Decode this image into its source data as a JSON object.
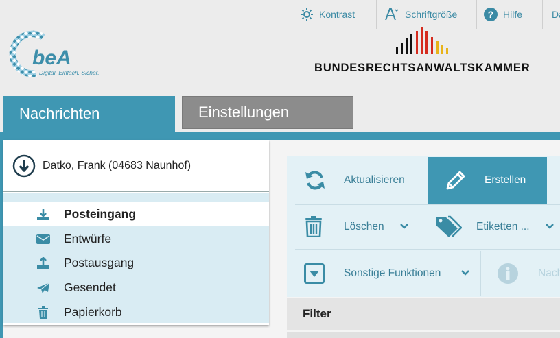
{
  "topbar": {
    "kontrast": "Kontrast",
    "schriftgroesse": "Schriftgröße",
    "hilfe": "Hilfe",
    "more": "Da"
  },
  "logo": {
    "bea_word": "beA",
    "bea_tagline": "Digital. Einfach. Sicher.",
    "brak_name": "BUNDESRECHTSANWALTSKAMMER"
  },
  "tabs": [
    {
      "label": "Nachrichten",
      "active": true
    },
    {
      "label": "Einstellungen",
      "active": false
    }
  ],
  "account": {
    "name": "Datko, Frank (04683 Naunhof)"
  },
  "nav": {
    "items": [
      {
        "label": "Posteingang",
        "icon": "inbox-download-icon",
        "active": true
      },
      {
        "label": "Entwürfe",
        "icon": "envelope-icon",
        "active": false
      },
      {
        "label": "Postausgang",
        "icon": "outbox-upload-icon",
        "active": false
      },
      {
        "label": "Gesendet",
        "icon": "paper-plane-icon",
        "active": false
      },
      {
        "label": "Papierkorb",
        "icon": "trash-icon",
        "active": false
      }
    ]
  },
  "toolbar": {
    "refresh": "Aktualisieren",
    "create": "Erstellen",
    "delete": "Löschen",
    "labels": "Etiketten ...",
    "other": "Sonstige Funktionen",
    "next": "Nach"
  },
  "filter": {
    "label": "Filter"
  },
  "colors": {
    "accent": "#3f97b3",
    "nav_bg": "#d9ecf3",
    "toolbar_bg": "#e3f1f6",
    "tab_inactive": "#8c8c8c"
  }
}
